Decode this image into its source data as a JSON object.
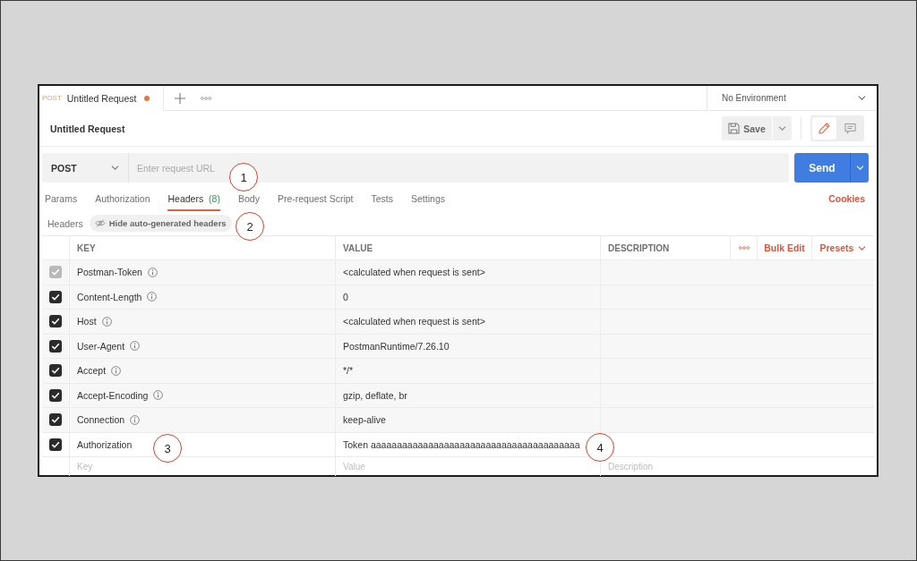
{
  "tab_bar": {
    "tabs": [
      {
        "method": "POST",
        "title": "Untitled Request",
        "unsaved": true,
        "selected": true
      }
    ],
    "environment": "No Environment"
  },
  "request": {
    "title": "Untitled Request",
    "save_button": "Save",
    "view_toggle": [
      {
        "kind": "edit",
        "selected": true
      },
      {
        "kind": "comments",
        "selected": false
      }
    ]
  },
  "url_bar": {
    "method": "POST",
    "placeholder": "Enter request URL",
    "send_button": "Send"
  },
  "request_tabs": [
    {
      "label": "Params",
      "selected": false
    },
    {
      "label": "Authorization",
      "selected": false
    },
    {
      "label": "Headers",
      "count": "(8)",
      "selected": true
    },
    {
      "label": "Body",
      "selected": false
    },
    {
      "label": "Pre-request Script",
      "selected": false
    },
    {
      "label": "Tests",
      "selected": false
    },
    {
      "label": "Settings",
      "selected": false
    }
  ],
  "cookies_link": "Cookies",
  "headers_toolbar": {
    "title": "Headers",
    "toggle_button": "Hide auto-generated headers"
  },
  "table": {
    "columns": [
      "KEY",
      "VALUE",
      "DESCRIPTION"
    ],
    "actions": [
      "Bulk Edit",
      "Presets"
    ],
    "rows": [
      {
        "kind": "auto",
        "key": "Postman-Token",
        "value": "<calculated when request is sent>",
        "checked": true,
        "disabled": true
      },
      {
        "kind": "auto",
        "key": "Content-Length",
        "value": "0",
        "checked": true,
        "disabled": false
      },
      {
        "kind": "auto",
        "key": "Host",
        "value": "<calculated when request is sent>",
        "checked": true,
        "disabled": false
      },
      {
        "kind": "auto",
        "key": "User-Agent",
        "value": "PostmanRuntime/7.26.10",
        "checked": true,
        "disabled": false
      },
      {
        "kind": "auto",
        "key": "Accept",
        "value": "*/*",
        "checked": true,
        "disabled": false
      },
      {
        "kind": "auto",
        "key": "Accept-Encoding",
        "value": "gzip, deflate, br",
        "checked": true,
        "disabled": false
      },
      {
        "kind": "auto",
        "key": "Connection",
        "value": "keep-alive",
        "checked": true,
        "disabled": false
      },
      {
        "kind": "custom",
        "key": "Authorization",
        "value": "Token aaaaaaaaaaaaaaaaaaaaaaaaaaaaaaaaaaaaaaaa",
        "checked": true,
        "disabled": false
      }
    ],
    "new_row": {
      "key_placeholder": "Key",
      "value_placeholder": "Value",
      "description_placeholder": "Description"
    }
  },
  "annotations": [
    {
      "label": "1"
    },
    {
      "label": "2"
    },
    {
      "label": "3"
    },
    {
      "label": "4"
    }
  ]
}
